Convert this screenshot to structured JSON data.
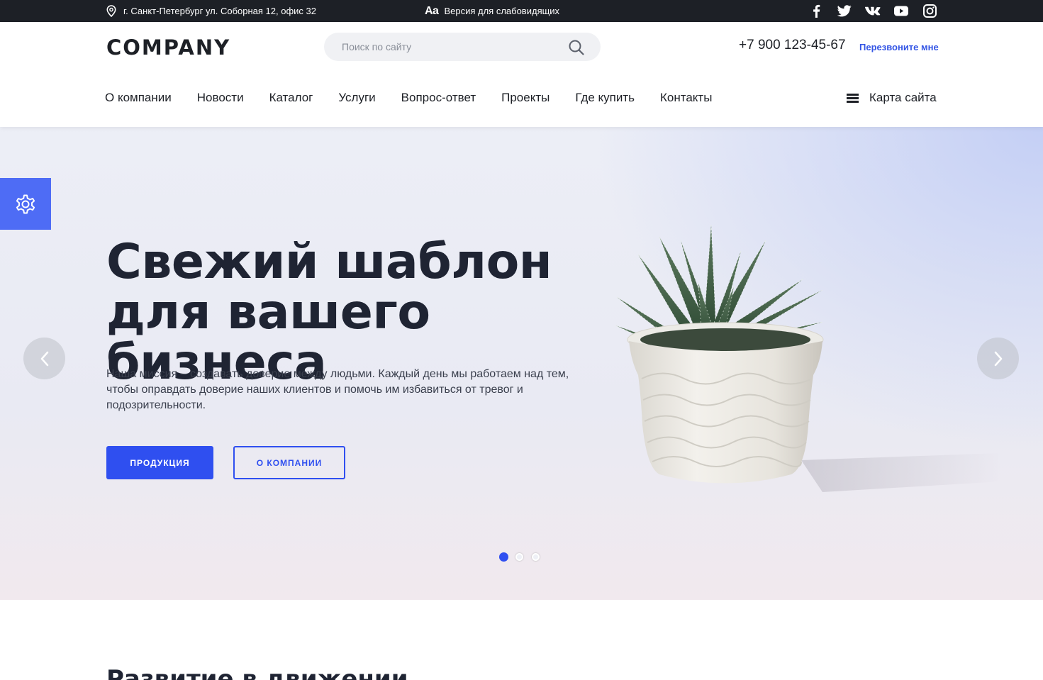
{
  "topbar": {
    "address": "г. Санкт-Петербург ул. Соборная 12, офис 32",
    "vision_icon_text": "Aa",
    "vision_label": "Версия для слабовидящих",
    "socials": [
      "facebook-icon",
      "twitter-icon",
      "vk-icon",
      "youtube-icon",
      "instagram-icon"
    ]
  },
  "header": {
    "logo": "COMPANY",
    "search_placeholder": "Поиск по сайту",
    "phone": "+7 900 123-45-67",
    "callback": "Перезвоните мне",
    "nav": [
      "О компании",
      "Новости",
      "Каталог",
      "Услуги",
      "Вопрос-ответ",
      "Проекты",
      "Где купить",
      "Контакты"
    ],
    "sitemap": "Карта сайта"
  },
  "hero": {
    "title": "Свежий шаблон для вашего бизнеса",
    "text": "Наша миссия – создавать доверие между людьми. Каждый день мы работаем над тем, чтобы оправдать доверие наших клиентов и помочь им избавиться от тревог и подозрительности.",
    "primary_button": "ПРОДУКЦИЯ",
    "secondary_button": "О КОМПАНИИ",
    "slides_total": 3,
    "active_slide": 1
  },
  "next_section": {
    "title": "Развитие в движении"
  },
  "colors": {
    "accent": "#2f4ff0",
    "topbar_bg": "#1d2026",
    "settings_bg": "#4e6cf5"
  }
}
